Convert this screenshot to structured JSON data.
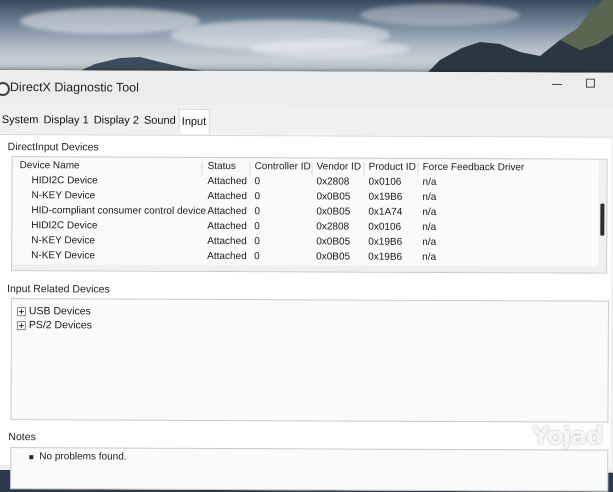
{
  "window": {
    "title": "DirectX Diagnostic Tool"
  },
  "tabs": [
    {
      "label": "System",
      "active": false
    },
    {
      "label": "Display 1",
      "active": false
    },
    {
      "label": "Display 2",
      "active": false
    },
    {
      "label": "Sound",
      "active": false
    },
    {
      "label": "Input",
      "active": true
    }
  ],
  "directinput": {
    "label": "DirectInput Devices",
    "columns": [
      "Device Name",
      "Status",
      "Controller ID",
      "Vendor ID",
      "Product ID",
      "Force Feedback Driver"
    ],
    "rows": [
      [
        "HIDI2C Device",
        "Attached",
        "0",
        "0x2808",
        "0x0106",
        "n/a"
      ],
      [
        "N-KEY Device",
        "Attached",
        "0",
        "0x0B05",
        "0x19B6",
        "n/a"
      ],
      [
        "HID-compliant consumer control device",
        "Attached",
        "0",
        "0x0B05",
        "0x1A74",
        "n/a"
      ],
      [
        "HIDI2C Device",
        "Attached",
        "0",
        "0x2808",
        "0x0106",
        "n/a"
      ],
      [
        "N-KEY Device",
        "Attached",
        "0",
        "0x0B05",
        "0x19B6",
        "n/a"
      ],
      [
        "N-KEY Device",
        "Attached",
        "0",
        "0x0B05",
        "0x19B6",
        "n/a"
      ]
    ]
  },
  "related": {
    "label": "Input Related Devices",
    "items": [
      "USB Devices",
      "PS/2 Devices"
    ]
  },
  "notes": {
    "label": "Notes",
    "lines": [
      "No problems found."
    ]
  },
  "watermark": "Yojad"
}
